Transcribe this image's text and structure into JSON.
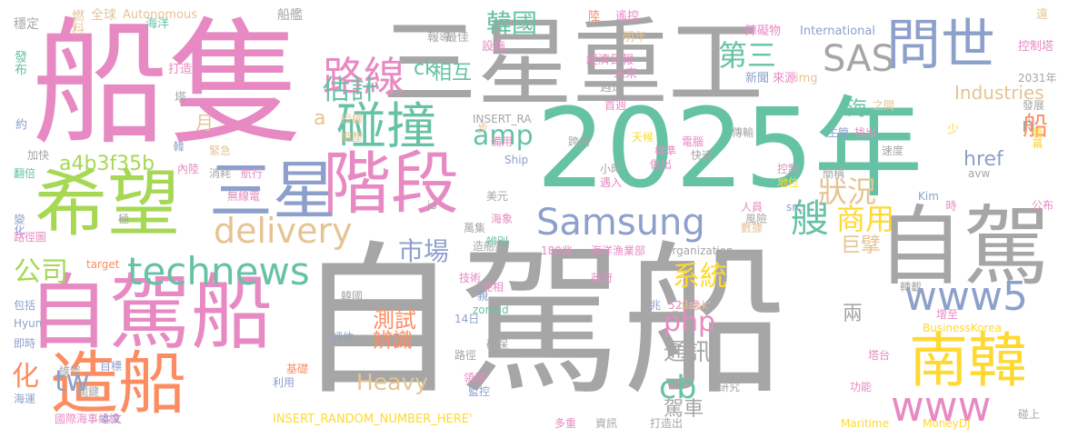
{
  "palette": {
    "gray": "#a6a6a6",
    "green": "#66c2a5",
    "pink": "#e78ac3",
    "blue": "#8da0cb",
    "lime": "#a6d854",
    "orange": "#fc8d62",
    "yellow": "#ffd92f",
    "tan": "#e5c494"
  },
  "words": [
    {
      "text": "自駕船",
      "color": "gray"
    },
    {
      "text": "2025年",
      "color": "green"
    },
    {
      "text": "船隻",
      "color": "pink"
    },
    {
      "text": "三星重工",
      "color": "gray"
    },
    {
      "text": "希望",
      "color": "lime"
    },
    {
      "text": "自駕船",
      "color": "pink"
    },
    {
      "text": "階段",
      "color": "pink"
    },
    {
      "text": "三星",
      "color": "blue"
    },
    {
      "text": "自駕",
      "color": "gray"
    },
    {
      "text": "造船",
      "color": "orange"
    },
    {
      "text": "南韓",
      "color": "yellow"
    },
    {
      "text": "問世",
      "color": "blue"
    },
    {
      "text": "Samsung",
      "color": "blue"
    },
    {
      "text": "technews",
      "color": "green"
    },
    {
      "text": "www5",
      "color": "blue"
    },
    {
      "text": "碰撞",
      "color": "green"
    },
    {
      "text": "路線",
      "color": "pink"
    },
    {
      "text": "delivery",
      "color": "tan"
    },
    {
      "text": "SAS",
      "color": "gray"
    },
    {
      "text": "艘",
      "color": "green"
    },
    {
      "text": "www",
      "color": "pink"
    },
    {
      "text": "韓國",
      "color": "green"
    },
    {
      "text": "估計",
      "color": "green"
    },
    {
      "text": "amp",
      "color": "green"
    },
    {
      "text": "第三",
      "color": "green"
    },
    {
      "text": "商用",
      "color": "yellow"
    },
    {
      "text": "狀況",
      "color": "tan"
    },
    {
      "text": "php",
      "color": "pink"
    },
    {
      "text": "系統",
      "color": "yellow"
    },
    {
      "text": "市場",
      "color": "blue"
    },
    {
      "text": "公司",
      "color": "lime"
    },
    {
      "text": "tw",
      "color": "blue"
    },
    {
      "text": "化",
      "color": "orange"
    },
    {
      "text": "cb",
      "color": "green"
    },
    {
      "text": "通訊",
      "color": "gray"
    },
    {
      "text": "Heavy",
      "color": "tan"
    },
    {
      "text": "ck",
      "color": "green"
    },
    {
      "text": "相互",
      "color": "green"
    },
    {
      "text": "a4b3f35b",
      "color": "lime"
    },
    {
      "text": "Industries",
      "color": "tan"
    },
    {
      "text": "巨擘",
      "color": "tan"
    },
    {
      "text": "駕車",
      "color": "gray"
    },
    {
      "text": "href",
      "color": "blue"
    },
    {
      "text": "測試",
      "color": "orange"
    },
    {
      "text": "辨識",
      "color": "orange"
    },
    {
      "text": "海",
      "color": "green"
    },
    {
      "text": "船",
      "color": "orange"
    },
    {
      "text": "n",
      "color": "gray"
    },
    {
      "text": "兩",
      "color": "gray"
    },
    {
      "text": "月",
      "color": "tan"
    },
    {
      "text": "a",
      "color": "tan"
    },
    {
      "text": "燃料",
      "color": "tan"
    },
    {
      "text": "全球",
      "color": "tan"
    },
    {
      "text": "Autonomous",
      "color": "tan"
    },
    {
      "text": "船艦",
      "color": "gray"
    },
    {
      "text": "陸",
      "color": "orange"
    },
    {
      "text": "遙控",
      "color": "pink"
    },
    {
      "text": "障礙物",
      "color": "pink"
    },
    {
      "text": "International",
      "color": "blue"
    },
    {
      "text": "控制塔",
      "color": "pink"
    },
    {
      "text": "遠",
      "color": "tan"
    },
    {
      "text": "穩定",
      "color": "gray"
    },
    {
      "text": "海洋",
      "color": "green"
    },
    {
      "text": "報導",
      "color": "gray"
    },
    {
      "text": "最佳",
      "color": "gray"
    },
    {
      "text": "設施",
      "color": "pink"
    },
    {
      "text": "經濟日報",
      "color": "pink"
    },
    {
      "text": "明年",
      "color": "tan"
    },
    {
      "text": "未來",
      "color": "pink"
    },
    {
      "text": "新聞",
      "color": "blue"
    },
    {
      "text": "來源",
      "color": "pink"
    },
    {
      "text": "週遭",
      "color": "gray"
    },
    {
      "text": "img",
      "color": "tan"
    },
    {
      "text": "2031年",
      "color": "gray"
    },
    {
      "text": "發布",
      "color": "green"
    },
    {
      "text": "打造",
      "color": "pink"
    },
    {
      "text": "塔",
      "color": "gray"
    },
    {
      "text": "授權",
      "color": "tan"
    },
    {
      "text": "INSERT_RA",
      "color": "gray"
    },
    {
      "text": "首週",
      "color": "pink"
    },
    {
      "text": "之間",
      "color": "tan"
    },
    {
      "text": "發展",
      "color": "gray"
    },
    {
      "text": "約",
      "color": "blue"
    },
    {
      "text": "調整",
      "color": "tan"
    },
    {
      "text": "步",
      "color": "tan"
    },
    {
      "text": "備用",
      "color": "pink"
    },
    {
      "text": "跨向",
      "color": "gray"
    },
    {
      "text": "天候",
      "color": "yellow"
    },
    {
      "text": "標準",
      "color": "pink"
    },
    {
      "text": "電腦",
      "color": "pink"
    },
    {
      "text": "傳輸",
      "color": "gray"
    },
    {
      "text": "主管",
      "color": "blue"
    },
    {
      "text": "找出",
      "color": "pink"
    },
    {
      "text": "少",
      "color": "yellow"
    },
    {
      "text": "螢幕",
      "color": "yellow"
    },
    {
      "text": "加快",
      "color": "gray"
    },
    {
      "text": "緊急",
      "color": "tan"
    },
    {
      "text": "韓",
      "color": "blue"
    },
    {
      "text": "快速",
      "color": "gray"
    },
    {
      "text": "做出",
      "color": "pink"
    },
    {
      "text": "小時",
      "color": "gray"
    },
    {
      "text": "速度",
      "color": "gray"
    },
    {
      "text": "翻倍",
      "color": "green"
    },
    {
      "text": "內陸",
      "color": "pink"
    },
    {
      "text": "消耗",
      "color": "gray"
    },
    {
      "text": "航行",
      "color": "pink"
    },
    {
      "text": "Ship",
      "color": "blue"
    },
    {
      "text": "遇入",
      "color": "pink"
    },
    {
      "text": "控制",
      "color": "pink"
    },
    {
      "text": "地位",
      "color": "yellow"
    },
    {
      "text": "簡稱",
      "color": "gray"
    },
    {
      "text": "avw",
      "color": "gray"
    },
    {
      "text": "變化",
      "color": "blue"
    },
    {
      "text": "無線電",
      "color": "pink"
    },
    {
      "text": "美元",
      "color": "gray"
    },
    {
      "text": "src",
      "color": "blue"
    },
    {
      "text": "Kim",
      "color": "blue"
    },
    {
      "text": "時",
      "color": "pink"
    },
    {
      "text": "公布",
      "color": "pink"
    },
    {
      "text": "極",
      "color": "gray"
    },
    {
      "text": "jo",
      "color": "gray"
    },
    {
      "text": "人員",
      "color": "pink"
    },
    {
      "text": "風險",
      "color": "gray"
    },
    {
      "text": "數據",
      "color": "tan"
    },
    {
      "text": "路徑圖",
      "color": "pink"
    },
    {
      "text": "萬集",
      "color": "gray"
    },
    {
      "text": "海象",
      "color": "pink"
    },
    {
      "text": "造船業",
      "color": "gray"
    },
    {
      "text": "辨別",
      "color": "green"
    },
    {
      "text": "180兆",
      "color": "pink"
    },
    {
      "text": "海洋漁業部",
      "color": "pink"
    },
    {
      "text": "Organization",
      "color": "gray"
    },
    {
      "text": "target",
      "color": "orange"
    },
    {
      "text": "技術",
      "color": "pink"
    },
    {
      "text": "亮相",
      "color": "pink"
    },
    {
      "text": "政府",
      "color": "pink"
    },
    {
      "text": "包括",
      "color": "blue"
    },
    {
      "text": "韓國",
      "color": "gray"
    },
    {
      "text": "親",
      "color": "blue"
    },
    {
      "text": "兆",
      "color": "blue"
    },
    {
      "text": "520億",
      "color": "pink"
    },
    {
      "text": "_blank'",
      "color": "tan"
    },
    {
      "text": "轉載",
      "color": "gray"
    },
    {
      "text": "增至",
      "color": "pink"
    },
    {
      "text": "Hyun",
      "color": "blue"
    },
    {
      "text": "評估",
      "color": "blue"
    },
    {
      "text": "zoneid",
      "color": "green"
    },
    {
      "text": "14日",
      "color": "blue"
    },
    {
      "text": "BusinessKorea",
      "color": "yellow"
    },
    {
      "text": "即時",
      "color": "blue"
    },
    {
      "text": "確保",
      "color": "gray"
    },
    {
      "text": "塔台",
      "color": "pink"
    },
    {
      "text": "維修",
      "color": "gray"
    },
    {
      "text": "目標",
      "color": "blue"
    },
    {
      "text": "基礎",
      "color": "orange"
    },
    {
      "text": "路徑",
      "color": "gray"
    },
    {
      "text": "領導",
      "color": "pink"
    },
    {
      "text": "研究",
      "color": "gray"
    },
    {
      "text": "功能",
      "color": "pink"
    },
    {
      "text": "海運",
      "color": "blue"
    },
    {
      "text": "關鍵",
      "color": "gray"
    },
    {
      "text": "利用",
      "color": "blue"
    },
    {
      "text": "監控",
      "color": "blue"
    },
    {
      "text": "國際海事組織",
      "color": "pink"
    },
    {
      "text": "本文",
      "color": "blue"
    },
    {
      "text": "INSERT_RANDOM_NUMBER_HERE'",
      "color": "yellow"
    },
    {
      "text": "多重",
      "color": "pink"
    },
    {
      "text": "資訊",
      "color": "gray"
    },
    {
      "text": "打造出",
      "color": "gray"
    },
    {
      "text": "Maritime",
      "color": "yellow"
    },
    {
      "text": "MoneyDJ",
      "color": "yellow"
    },
    {
      "text": "碰上",
      "color": "gray"
    }
  ]
}
